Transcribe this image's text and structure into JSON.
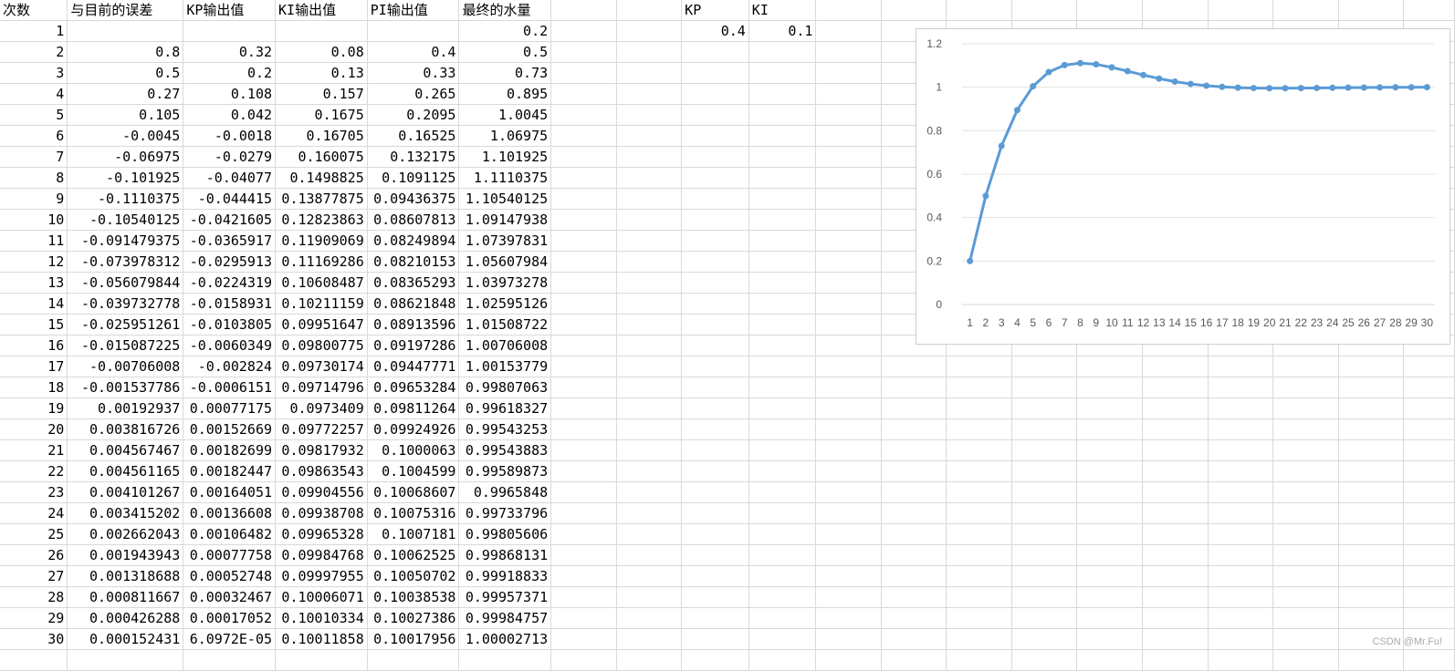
{
  "headers": [
    "次数",
    "与目前的误差",
    "KP输出值",
    "KI输出值",
    "PI输出值",
    "最终的水量"
  ],
  "params": {
    "kp_label": "KP",
    "ki_label": "KI",
    "kp_value": "0.4",
    "ki_value": "0.1"
  },
  "rows": [
    [
      "1",
      "",
      "",
      "",
      "",
      "0.2"
    ],
    [
      "2",
      "0.8",
      "0.32",
      "0.08",
      "0.4",
      "0.5"
    ],
    [
      "3",
      "0.5",
      "0.2",
      "0.13",
      "0.33",
      "0.73"
    ],
    [
      "4",
      "0.27",
      "0.108",
      "0.157",
      "0.265",
      "0.895"
    ],
    [
      "5",
      "0.105",
      "0.042",
      "0.1675",
      "0.2095",
      "1.0045"
    ],
    [
      "6",
      "-0.0045",
      "-0.0018",
      "0.16705",
      "0.16525",
      "1.06975"
    ],
    [
      "7",
      "-0.06975",
      "-0.0279",
      "0.160075",
      "0.132175",
      "1.101925"
    ],
    [
      "8",
      "-0.101925",
      "-0.04077",
      "0.1498825",
      "0.1091125",
      "1.1110375"
    ],
    [
      "9",
      "-0.1110375",
      "-0.044415",
      "0.13877875",
      "0.09436375",
      "1.10540125"
    ],
    [
      "10",
      "-0.10540125",
      "-0.0421605",
      "0.12823863",
      "0.08607813",
      "1.09147938"
    ],
    [
      "11",
      "-0.091479375",
      "-0.0365917",
      "0.11909069",
      "0.08249894",
      "1.07397831"
    ],
    [
      "12",
      "-0.073978312",
      "-0.0295913",
      "0.11169286",
      "0.08210153",
      "1.05607984"
    ],
    [
      "13",
      "-0.056079844",
      "-0.0224319",
      "0.10608487",
      "0.08365293",
      "1.03973278"
    ],
    [
      "14",
      "-0.039732778",
      "-0.0158931",
      "0.10211159",
      "0.08621848",
      "1.02595126"
    ],
    [
      "15",
      "-0.025951261",
      "-0.0103805",
      "0.09951647",
      "0.08913596",
      "1.01508722"
    ],
    [
      "16",
      "-0.015087225",
      "-0.0060349",
      "0.09800775",
      "0.09197286",
      "1.00706008"
    ],
    [
      "17",
      "-0.00706008",
      "-0.002824",
      "0.09730174",
      "0.09447771",
      "1.00153779"
    ],
    [
      "18",
      "-0.001537786",
      "-0.0006151",
      "0.09714796",
      "0.09653284",
      "0.99807063"
    ],
    [
      "19",
      "0.00192937",
      "0.00077175",
      "0.0973409",
      "0.09811264",
      "0.99618327"
    ],
    [
      "20",
      "0.003816726",
      "0.00152669",
      "0.09772257",
      "0.09924926",
      "0.99543253"
    ],
    [
      "21",
      "0.004567467",
      "0.00182699",
      "0.09817932",
      "0.1000063",
      "0.99543883"
    ],
    [
      "22",
      "0.004561165",
      "0.00182447",
      "0.09863543",
      "0.1004599",
      "0.99589873"
    ],
    [
      "23",
      "0.004101267",
      "0.00164051",
      "0.09904556",
      "0.10068607",
      "0.9965848"
    ],
    [
      "24",
      "0.003415202",
      "0.00136608",
      "0.09938708",
      "0.10075316",
      "0.99733796"
    ],
    [
      "25",
      "0.002662043",
      "0.00106482",
      "0.09965328",
      "0.1007181",
      "0.99805606"
    ],
    [
      "26",
      "0.001943943",
      "0.00077758",
      "0.09984768",
      "0.10062525",
      "0.99868131"
    ],
    [
      "27",
      "0.001318688",
      "0.00052748",
      "0.09997955",
      "0.10050702",
      "0.99918833"
    ],
    [
      "28",
      "0.000811667",
      "0.00032467",
      "0.10006071",
      "0.10038538",
      "0.99957371"
    ],
    [
      "29",
      "0.000426288",
      "0.00017052",
      "0.10010334",
      "0.10027386",
      "0.99984757"
    ],
    [
      "30",
      "0.000152431",
      "6.0972E-05",
      "0.10011858",
      "0.10017956",
      "1.00002713"
    ]
  ],
  "chart_data": {
    "type": "line",
    "x": [
      1,
      2,
      3,
      4,
      5,
      6,
      7,
      8,
      9,
      10,
      11,
      12,
      13,
      14,
      15,
      16,
      17,
      18,
      19,
      20,
      21,
      22,
      23,
      24,
      25,
      26,
      27,
      28,
      29,
      30
    ],
    "series": [
      {
        "values": [
          0.2,
          0.5,
          0.73,
          0.895,
          1.0045,
          1.06975,
          1.101925,
          1.1110375,
          1.10540125,
          1.09147938,
          1.07397831,
          1.05607984,
          1.03973278,
          1.02595126,
          1.01508722,
          1.00706008,
          1.00153779,
          0.99807063,
          0.99618327,
          0.99543253,
          0.99543883,
          0.99589873,
          0.9965848,
          0.99733796,
          0.99805606,
          0.99868131,
          0.99918833,
          0.99957371,
          0.99984757,
          1.00002713
        ]
      }
    ],
    "yticks": [
      0,
      0.2,
      0.4,
      0.6,
      0.8,
      1,
      1.2
    ],
    "ylim": [
      0,
      1.2
    ],
    "color": "#5b9bd5",
    "grid": true,
    "legend": false
  },
  "watermark": "CSDN @Mr.Fu!"
}
